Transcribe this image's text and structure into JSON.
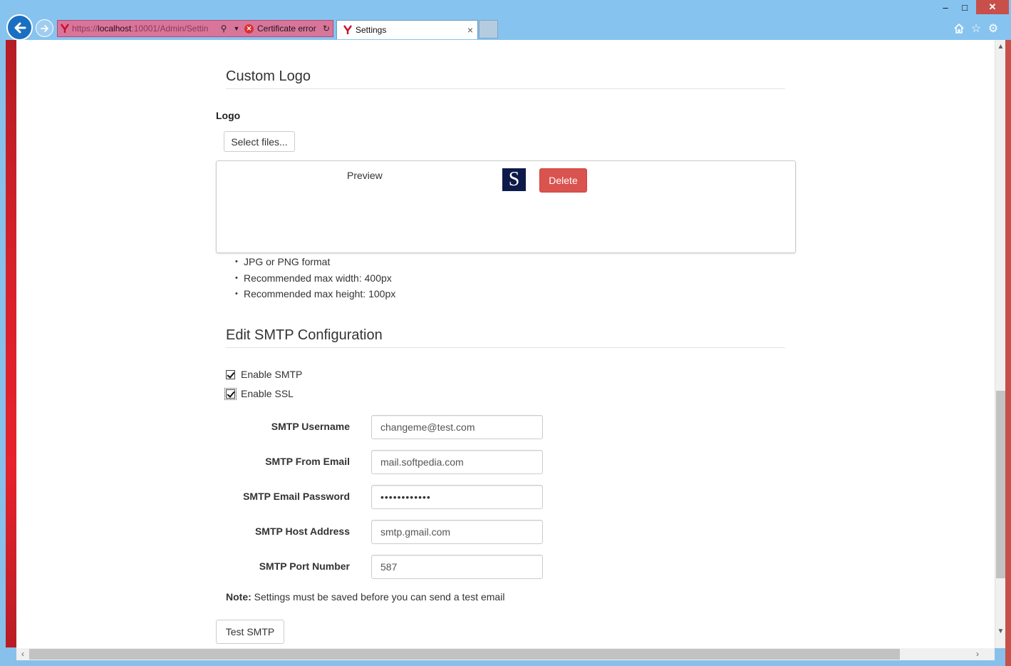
{
  "browser": {
    "address_url_prefix": "https://",
    "address_url_host": "localhost",
    "address_url_rest": ":10001/Admin/Settin",
    "certificate_error": "Certificate error",
    "tab_title": "Settings",
    "tab_close": "×",
    "win_minimize": "‒",
    "win_maximize": "□",
    "win_close": "✕"
  },
  "custom_logo": {
    "heading": "Custom Logo",
    "logo_label": "Logo",
    "select_files_button": "Select files...",
    "preview_label": "Preview",
    "logo_letter": "S",
    "delete_button": "Delete",
    "hints": [
      "JPG or PNG format",
      "Recommended max width: 400px",
      "Recommended max height: 100px"
    ]
  },
  "smtp": {
    "heading": "Edit SMTP Configuration",
    "enable_smtp": {
      "label": "Enable SMTP",
      "checked": true
    },
    "enable_ssl": {
      "label": "Enable SSL",
      "checked": true
    },
    "fields": [
      {
        "label": "SMTP Username",
        "value": "changeme@test.com",
        "type": "text"
      },
      {
        "label": "SMTP From Email",
        "value": "mail.softpedia.com",
        "type": "text"
      },
      {
        "label": "SMTP Email Password",
        "value": "••••••••••••",
        "type": "password"
      },
      {
        "label": "SMTP Host Address",
        "value": "smtp.gmail.com",
        "type": "text"
      },
      {
        "label": "SMTP Port Number",
        "value": "587",
        "type": "text"
      }
    ],
    "note_bold": "Note:",
    "note_text": " Settings must be saved before you can send a test email",
    "test_button": "Test SMTP"
  },
  "colors": {
    "delete_button_bg": "#d9534f",
    "chrome_blue": "#87c3ef",
    "address_error_pink": "#d9759b",
    "logo_navy": "#0e1a4a"
  },
  "icons": [
    "back-arrow-icon",
    "forward-arrow-icon",
    "site-favicon",
    "search-icon",
    "certificate-error-icon",
    "refresh-icon",
    "home-icon",
    "favorites-star-icon",
    "settings-gear-icon"
  ]
}
